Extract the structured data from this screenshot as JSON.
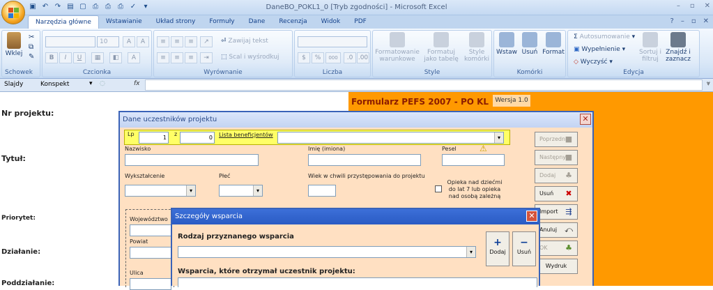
{
  "window": {
    "title": "DaneBO_POKL1_0  [Tryb zgodności] - Microsoft Excel",
    "minimize": "–",
    "maximize": "▫",
    "close": "✕"
  },
  "tabs": [
    {
      "label": "Narzędzia główne",
      "active": true
    },
    {
      "label": "Wstawianie"
    },
    {
      "label": "Układ strony"
    },
    {
      "label": "Formuły"
    },
    {
      "label": "Dane"
    },
    {
      "label": "Recenzja"
    },
    {
      "label": "Widok"
    },
    {
      "label": "PDF"
    }
  ],
  "tab_right": {
    "help": "?",
    "minimize": "–",
    "restore": "▫",
    "close": "✕"
  },
  "ribbon": {
    "schowek": {
      "label": "Schowek",
      "paste": "Wklej"
    },
    "czcionka": {
      "label": "Czcionka",
      "size": "10",
      "bold": "B",
      "italic": "I",
      "underline": "U",
      "grow": "A",
      "shrink": "A"
    },
    "wyrownanie": {
      "label": "Wyrównanie",
      "wrap": "Zawijaj tekst",
      "merge": "Scal i wyśrodkuj"
    },
    "liczba": {
      "label": "Liczba",
      "percent": "%",
      "thousands": "000"
    },
    "style": {
      "label": "Style",
      "cond": "Formatowanie warunkowe",
      "table": "Formatuj jako tabelę",
      "cell": "Style komórki"
    },
    "komorki": {
      "label": "Komórki",
      "insert": "Wstaw",
      "delete": "Usuń",
      "format": "Format"
    },
    "edycja": {
      "label": "Edycja",
      "autosum": "Autosumowanie",
      "fill": "Wypełnienie",
      "clear": "Wyczyść",
      "sort": "Sortuj i filtruj",
      "find": "Znajdź i zaznacz"
    }
  },
  "formula_bar": {
    "tab1": "Slajdy",
    "tab2": "Konspekt",
    "fx": "fx"
  },
  "sheet": {
    "banner": "Formularz PEFS 2007 - PO KL",
    "version": "Wersja 1.0",
    "labels": [
      "Nr projektu:",
      "Tytuł:",
      "Priorytet:",
      "Działanie:",
      "Poddziałanie:"
    ]
  },
  "dialog": {
    "title": "Dane uczestników projektu",
    "lp_label": "Lp",
    "lp_value": "1",
    "z_label": "z",
    "z_value": "0",
    "list_label": "Lista beneficjentów",
    "nazwisko": "Nazwisko",
    "imie": "Imię (imiona)",
    "pesel": "Pesel",
    "wyksztalcenie": "Wykształcenie",
    "plec": "Płeć",
    "wiek": "Wiek w chwili przystępowania do projektu",
    "opieka": "Opieka nad dziećmi do lat 7 lub opieka nad osobą zależną",
    "wojewodztwo": "Województwo",
    "powiat": "Powiat",
    "ulica": "Ulica",
    "buttons": {
      "poprzedni": "Poprzedni",
      "nastepny": "Następny",
      "dodaj": "Dodaj",
      "usun": "Usuń",
      "import": "Import",
      "anuluj": "Anuluj",
      "ok": "OK",
      "wydruk": "Wydruk"
    }
  },
  "dialog2": {
    "title": "Szczegóły wsparcia",
    "rodzaj": "Rodzaj przyznanego wsparcia",
    "wsparcia": "Wsparcia, które otrzymał uczestnik projektu:",
    "add": "Dodaj",
    "remove": "Usuń",
    "plus": "+",
    "minus": "−"
  }
}
